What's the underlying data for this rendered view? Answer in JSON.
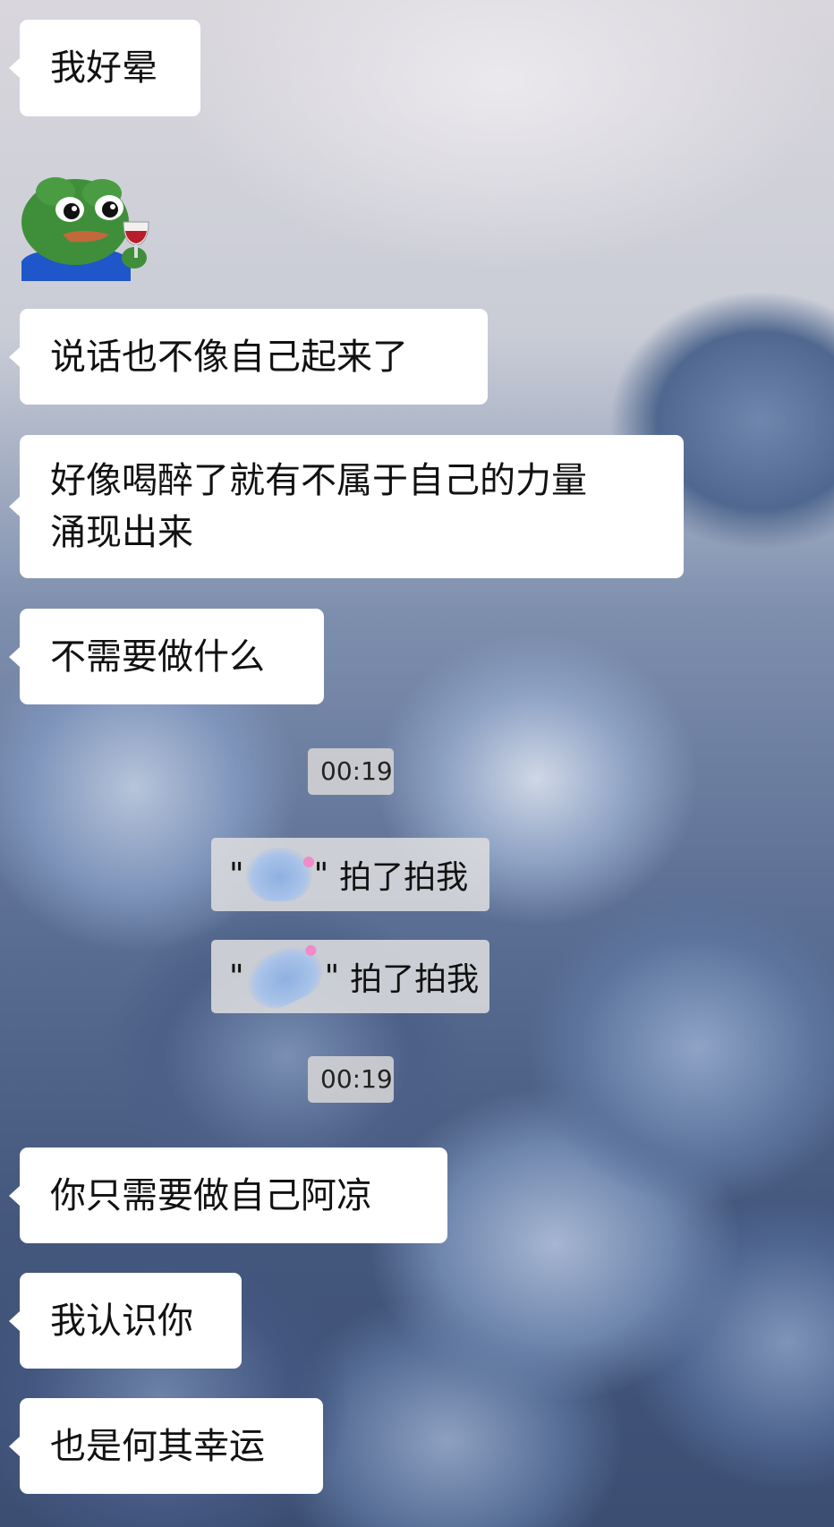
{
  "messages": [
    {
      "text": "我好晕"
    },
    {
      "text": "说话也不像自己起来了"
    },
    {
      "line1": "好像喝醉了就有不属于自己的力量",
      "line2": "涌现出来"
    },
    {
      "text": "不需要做什么"
    },
    {
      "text": "你只需要做自己阿凉"
    },
    {
      "text": "我认识你"
    },
    {
      "text": "也是何其幸运"
    }
  ],
  "timestamps": [
    "00:19",
    "00:19"
  ],
  "pats": [
    {
      "open_quote": "\"",
      "close_quote": "\"",
      "action": "拍了拍我"
    },
    {
      "open_quote": "\"",
      "close_quote": "\"",
      "action": "拍了拍我"
    }
  ],
  "sticker": {
    "icon": "pepe-frog-wine-sticker"
  },
  "colors": {
    "bubble": "#ffffff",
    "system_pill": "#dcdcde",
    "name_blur": "#a9c3ea"
  }
}
